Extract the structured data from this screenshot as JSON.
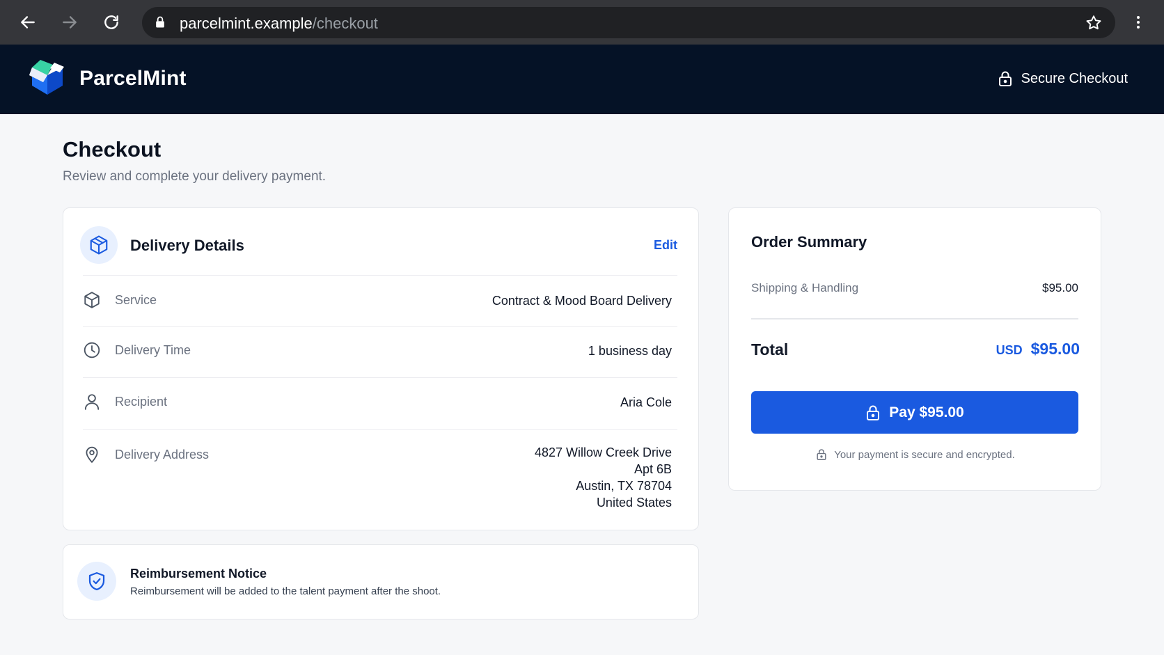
{
  "browser": {
    "url_host": "parcelmint.example",
    "url_path": "/checkout",
    "icons": [
      "back-icon",
      "forward-icon",
      "reload-icon",
      "lock-icon",
      "star-icon",
      "more-vert-icon"
    ]
  },
  "header": {
    "brand": "ParcelMint",
    "secure_label": "Secure Checkout"
  },
  "page": {
    "title": "Checkout",
    "subtitle": "Review and complete your delivery payment."
  },
  "delivery": {
    "title": "Delivery Details",
    "edit_label": "Edit",
    "rows": [
      {
        "label": "Service",
        "value": "Contract & Mood Board Delivery",
        "icon": "box-icon"
      },
      {
        "label": "Delivery Time",
        "value": "1 business day",
        "icon": "clock-icon"
      },
      {
        "label": "Recipient",
        "value": "Aria Cole",
        "icon": "person-icon"
      },
      {
        "label": "Delivery Address",
        "icon": "location-pin-icon",
        "address": [
          "4827 Willow Creek Drive",
          "Apt 6B",
          "Austin, TX 78704",
          "United States"
        ]
      }
    ]
  },
  "notice": {
    "title": "Reimbursement Notice",
    "text": "Reimbursement will be added to the talent payment after the shoot."
  },
  "summary": {
    "title": "Order Summary",
    "line_label": "Shipping & Handling",
    "line_value": "$95.00",
    "total_label": "Total",
    "currency": "USD",
    "total_value": "$95.00",
    "pay_label": "Pay $95.00",
    "secure_note": "Your payment is secure and encrypted."
  },
  "colors": {
    "accent": "#1a5ae0",
    "header_bg": "#051226",
    "page_bg": "#f6f7f9"
  }
}
